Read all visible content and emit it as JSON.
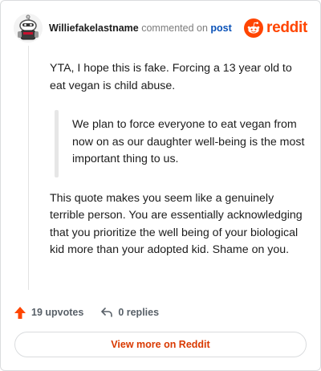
{
  "header": {
    "username": "Williefakelastname",
    "action_text": "commented on",
    "post_link": "post",
    "brand": "reddit"
  },
  "comment": {
    "paragraph1": "YTA, I hope this is fake. Forcing a 13 year old to eat vegan is child abuse.",
    "quote": "We plan to force everyone to eat vegan from now on as our daughter well-being is the most important thing to us.",
    "paragraph2": "This quote makes you seem like a genuinely terrible person. You are essentially acknowledging that you prioritize the well being of your biological kid more than your adopted kid. Shame on you."
  },
  "footer": {
    "upvotes": "19 upvotes",
    "replies": "0 replies",
    "view_more": "View more on Reddit"
  },
  "colors": {
    "brand": "#ff4500",
    "link": "#0a52b8",
    "view_more_text": "#d93900"
  },
  "icons": {
    "avatar": "snoo-avatar-icon",
    "brand": "reddit-logo-icon",
    "upvote": "upvote-arrow-icon",
    "reply": "reply-arrow-icon"
  }
}
